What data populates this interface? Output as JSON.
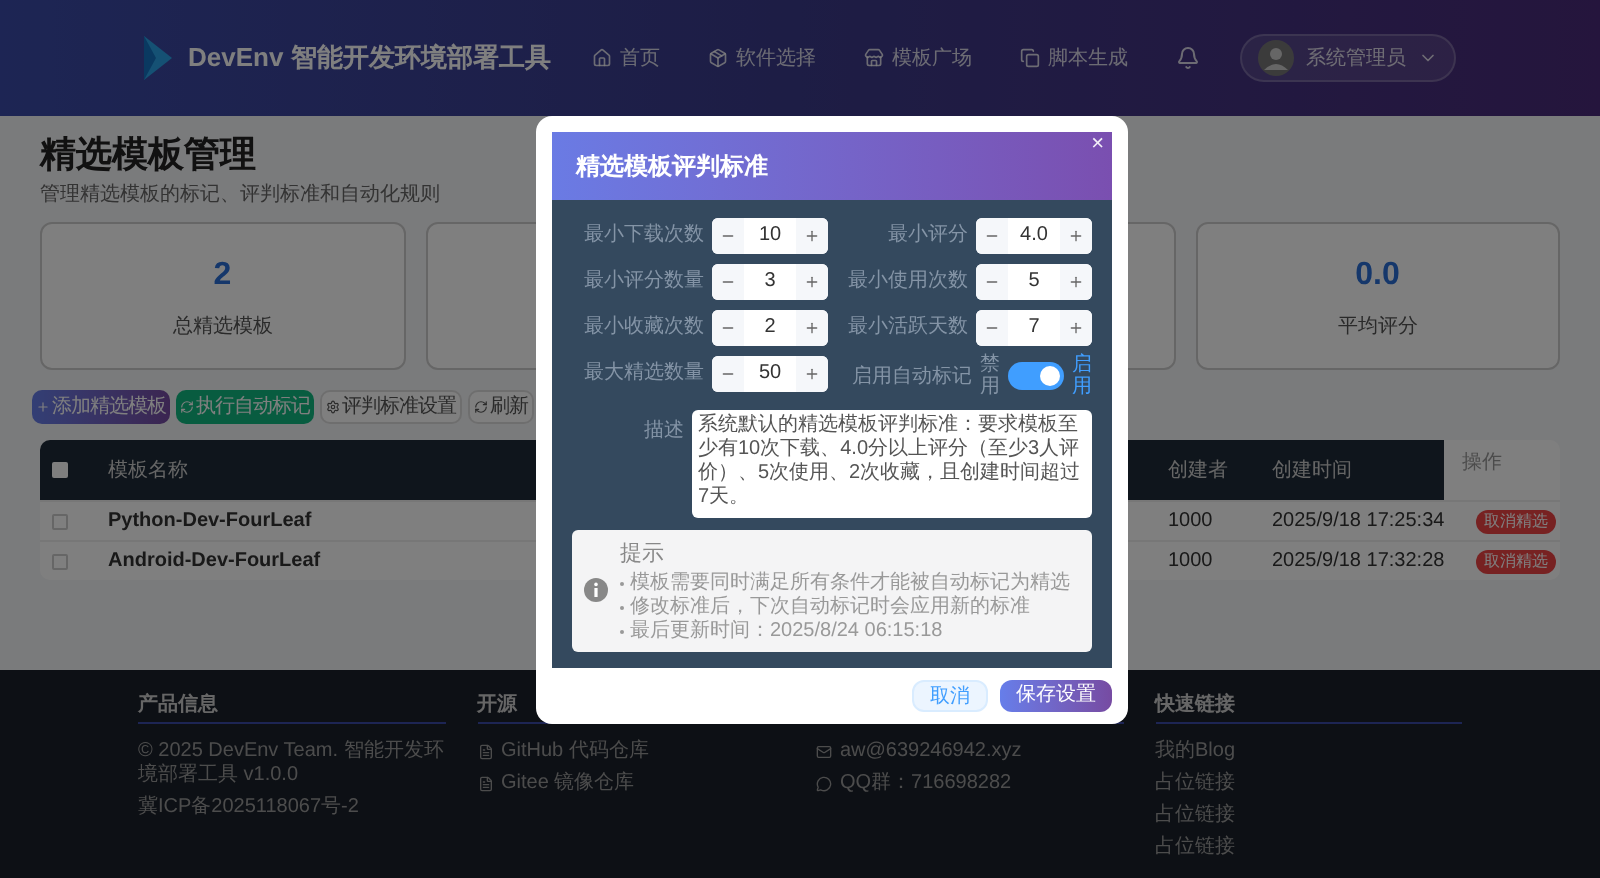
{
  "header": {
    "brand": "DevEnv 智能开发环境部署工具",
    "nav": [
      {
        "label": "首页"
      },
      {
        "label": "软件选择"
      },
      {
        "label": "模板广场"
      },
      {
        "label": "脚本生成"
      }
    ],
    "user": {
      "name": "系统管理员"
    }
  },
  "page": {
    "title": "精选模板管理",
    "subtitle": "管理精选模板的标记、评判标准和自动化规则"
  },
  "stats": [
    {
      "value": "2",
      "label": "总精选模板"
    },
    {
      "value": "0.0",
      "label": "平均评分"
    }
  ],
  "actions": [
    {
      "label": "添加精选模板",
      "kind": "primary"
    },
    {
      "label": "执行自动标记",
      "kind": "success"
    },
    {
      "label": "评判标准设置",
      "kind": "plain"
    },
    {
      "label": "刷新",
      "kind": "plain"
    }
  ],
  "table": {
    "all_checked": false,
    "columns": [
      "模板名称",
      "创建者",
      "创建时间",
      "操作"
    ],
    "rows": [
      {
        "name": "Python-Dev-FourLeaf",
        "creator": "1000",
        "time": "2025/9/18 17:25:34",
        "action": "取消精选",
        "checked": false
      },
      {
        "name": "Android-Dev-FourLeaf",
        "creator": "1000",
        "time": "2025/9/18 17:32:28",
        "action": "取消精选",
        "checked": false
      }
    ]
  },
  "footer": {
    "columns": [
      {
        "title": "产品信息",
        "items": [
          {
            "text": "© 2025 DevEnv Team. 智能开发环境部署工具 v1.0.0"
          },
          {
            "text": "冀ICP备2025118067号-2"
          }
        ]
      },
      {
        "title": "开源",
        "items": [
          {
            "text": "GitHub 代码仓库"
          },
          {
            "text": "Gitee 镜像仓库"
          }
        ]
      },
      {
        "items": [
          {
            "text": "aw@639246942.xyz"
          },
          {
            "text": "QQ群：716698282"
          }
        ]
      },
      {
        "title": "快速链接",
        "items": [
          {
            "text": "我的Blog"
          },
          {
            "text": "占位链接"
          },
          {
            "text": "占位链接"
          },
          {
            "text": "占位链接"
          }
        ]
      }
    ]
  },
  "modal": {
    "title": "精选模板评判标准",
    "close": "×",
    "fields": [
      {
        "label": "最小下载次数",
        "value": "10"
      },
      {
        "label": "最小评分",
        "value": "4.0"
      },
      {
        "label": "最小评分数量",
        "value": "3"
      },
      {
        "label": "最小使用次数",
        "value": "5"
      },
      {
        "label": "最小收藏次数",
        "value": "2"
      },
      {
        "label": "最小活跃天数",
        "value": "7"
      },
      {
        "label": "最大精选数量",
        "value": "50"
      }
    ],
    "auto_mark": {
      "label": "启用自动标记",
      "off_text": "禁用",
      "on_text": "启用",
      "on": true
    },
    "description": {
      "label": "描述",
      "value": "系统默认的精选模板评判标准：要求模板至少有10次下载、4.0分以上评分（至少3人评价）、5次使用、2次收藏，且创建时间超过7天。"
    },
    "tip": {
      "title": "提示",
      "items": [
        "模板需要同时满足所有条件才能被自动标记为精选",
        "修改标准后，下次自动标记时会应用新的标准",
        "最后更新时间：2025/8/24 06:15:18"
      ]
    },
    "buttons": [
      {
        "label": "取消",
        "kind": "secondary"
      },
      {
        "label": "保存设置",
        "kind": "primary"
      }
    ]
  }
}
